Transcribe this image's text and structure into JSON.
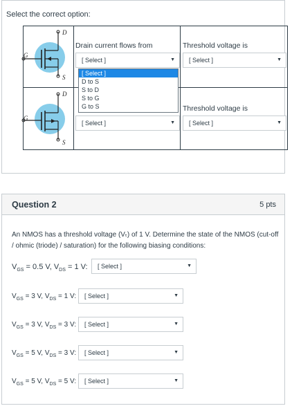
{
  "q1": {
    "instruction": "Select the correct option:",
    "header_drain": "Drain current flows from",
    "header_threshold": "Threshold voltage is",
    "terminals": {
      "g": "G",
      "d": "D",
      "s": "S"
    },
    "select_placeholder": "[ Select ]",
    "dropdown_options": [
      "[ Select ]",
      "D to S",
      "S to D",
      "S to G",
      "G to S"
    ]
  },
  "q2": {
    "title": "Question 2",
    "points": "5 pts",
    "text": "An NMOS has a threshold voltage (Vₜ) of 1 V. Determine the state of the NMOS (cut-off / ohmic (triode) / saturation) for the following biasing conditions:",
    "conditions": [
      {
        "vgs": "0.5 V",
        "vds": "1 V",
        "value": "[ Select ]"
      },
      {
        "vgs": "3 V",
        "vds": "1 V",
        "value": "[ Select ]"
      },
      {
        "vgs": "3 V",
        "vds": "3 V",
        "value": "[ Select ]"
      },
      {
        "vgs": "5 V",
        "vds": "3 V",
        "value": "[ Select ]"
      },
      {
        "vgs": "5 V",
        "vds": "5 V",
        "value": "[ Select ]"
      }
    ]
  }
}
